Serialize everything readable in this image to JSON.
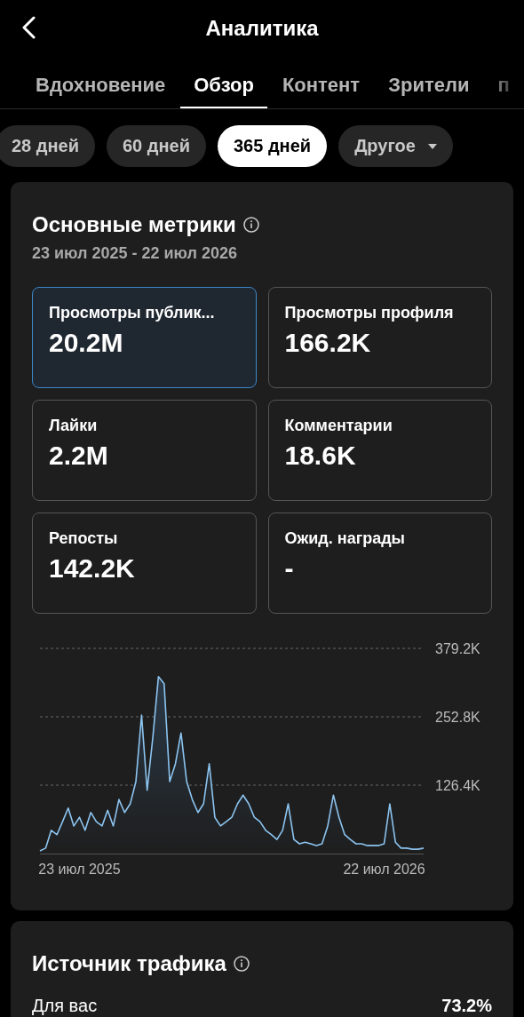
{
  "header": {
    "title": "Аналитика"
  },
  "tabs": [
    {
      "label": "Вдохновение",
      "selected": false
    },
    {
      "label": "Обзор",
      "selected": true
    },
    {
      "label": "Контент",
      "selected": false
    },
    {
      "label": "Зрители",
      "selected": false
    },
    {
      "label": "п",
      "selected": false
    }
  ],
  "periods": [
    {
      "label": "28 дней",
      "selected": false,
      "kind": "pill"
    },
    {
      "label": "60 дней",
      "selected": false,
      "kind": "pill"
    },
    {
      "label": "365 дней",
      "selected": true,
      "kind": "pill"
    },
    {
      "label": "Другое",
      "selected": false,
      "kind": "dropdown"
    }
  ],
  "metrics_card": {
    "title": "Основные метрики",
    "date_range": "23 июл 2025 - 22 июл 2026",
    "metrics": [
      {
        "label": "Просмотры публик...",
        "value": "20.2M",
        "selected": true
      },
      {
        "label": "Просмотры профиля",
        "value": "166.2K",
        "selected": false
      },
      {
        "label": "Лайки",
        "value": "2.2M",
        "selected": false
      },
      {
        "label": "Комментарии",
        "value": "18.6K",
        "selected": false
      },
      {
        "label": "Репосты",
        "value": "142.2K",
        "selected": false
      },
      {
        "label": "Ожид. награды",
        "value": "-",
        "selected": false
      }
    ],
    "chart_data": {
      "type": "area",
      "ylim": [
        0,
        379.2
      ],
      "categories": [
        null,
        null,
        null,
        null,
        null,
        null,
        null,
        "23 июл 2025",
        null,
        null,
        null,
        null,
        null,
        null,
        null,
        null,
        null,
        null,
        null,
        null,
        null,
        null,
        null,
        null,
        null,
        null,
        null,
        null,
        null,
        null,
        null,
        null,
        null,
        null,
        null,
        null,
        null,
        null,
        null,
        null,
        null,
        null,
        null,
        null,
        null,
        null,
        null,
        null,
        null,
        null,
        null,
        null,
        null,
        null,
        null,
        null,
        null,
        null,
        null,
        null,
        null,
        "22 июл 2026",
        null,
        null,
        null,
        null,
        null,
        null,
        null
      ],
      "yticks": [
        {
          "value": 126.4,
          "label": "126.4K"
        },
        {
          "value": 252.8,
          "label": "252.8K"
        },
        {
          "value": 379.2,
          "label": "379.2K"
        }
      ],
      "series": [
        {
          "color": "#8cc4f0",
          "values": [
            5,
            10,
            43,
            35,
            59,
            84,
            51,
            67,
            43,
            76,
            59,
            51,
            80,
            51,
            100,
            76,
            92,
            133,
            256,
            117,
            215,
            327,
            314,
            133,
            166,
            223,
            133,
            100,
            76,
            92,
            166,
            67,
            51,
            59,
            67,
            92,
            108,
            92,
            67,
            59,
            43,
            35,
            26,
            43,
            92,
            26,
            18,
            21,
            18,
            15,
            18,
            51,
            108,
            67,
            35,
            26,
            18,
            18,
            15,
            15,
            15,
            18,
            92,
            21,
            10,
            10,
            8,
            8,
            10
          ]
        }
      ]
    }
  },
  "traffic_card": {
    "title": "Источник трафика",
    "rows": [
      {
        "label": "Для вас",
        "value": "73.2%"
      }
    ]
  }
}
